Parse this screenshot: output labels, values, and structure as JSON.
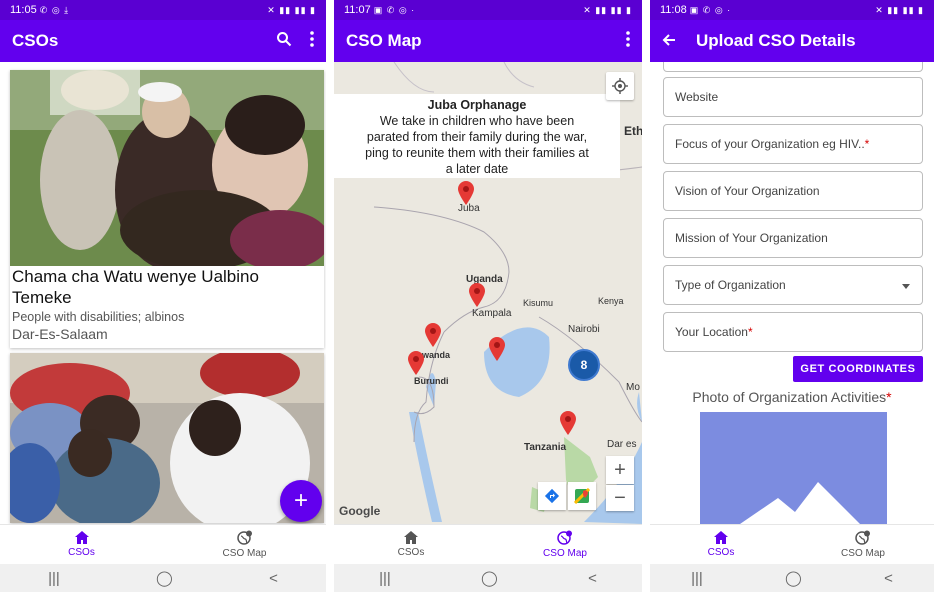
{
  "screen1": {
    "status": {
      "time": "11:05",
      "icons": "✆ ◎ ⤓",
      "right": "✕ ▮▮ ▮▮ ▮"
    },
    "appbar": {
      "title": "CSOs",
      "search_icon": "search-icon",
      "more_icon": "more-vert-icon"
    },
    "cards": [
      {
        "name": "Chama cha Watu wenye Ualbino Temeke",
        "focus": "People with disabilities; albinos",
        "location": "Dar-Es-Salaam"
      },
      {
        "name": "",
        "focus": "",
        "location": ""
      }
    ],
    "fab": "+",
    "nav": [
      {
        "label": "CSOs",
        "icon": "home-icon",
        "active": true
      },
      {
        "label": "CSO Map",
        "icon": "globe-pin-icon",
        "active": false
      }
    ],
    "sysnav": [
      "|||",
      "◯",
      "<"
    ]
  },
  "screen2": {
    "status": {
      "time": "11:07",
      "icons": "▣ ✆ ◎  ·",
      "right": "✕ ▮▮ ▮▮ ▮"
    },
    "appbar": {
      "title": "CSO Map",
      "more_icon": "more-vert-icon"
    },
    "popup": {
      "title": "Juba Orphanage",
      "lines": [
        "We take in children who have been",
        "parated from their family during the war,",
        "ping to reunite them with their families at",
        "a later date"
      ]
    },
    "labels": {
      "juba": "Juba",
      "uganda": "Uganda",
      "kampala": "Kampala",
      "kisumu": "Kisumu",
      "kenya": "Kenya",
      "nairobi": "Nairobi",
      "rwanda": "wanda",
      "burundi": "Burundi",
      "tanzania": "Tanzania",
      "dar": "Dar es",
      "eth": "Eth",
      "mo": "Mo"
    },
    "cluster_count": "8",
    "zoom_in": "+",
    "zoom_out": "−",
    "google": "Google",
    "nav": [
      {
        "label": "CSOs",
        "icon": "home-icon",
        "active": false
      },
      {
        "label": "CSO Map",
        "icon": "globe-pin-icon",
        "active": true
      }
    ],
    "sysnav": [
      "|||",
      "◯",
      "<"
    ]
  },
  "screen3": {
    "status": {
      "time": "11:08",
      "icons": "▣ ✆ ◎  ·",
      "right": "✕ ▮▮ ▮▮ ▮"
    },
    "appbar": {
      "title": "Upload CSO Details",
      "back_icon": "arrow-back-icon"
    },
    "fields": [
      {
        "label": "Website",
        "required": false
      },
      {
        "label": "Focus of your Organization eg HIV..",
        "required": true
      },
      {
        "label": "Vision of Your Organization",
        "required": false
      },
      {
        "label": "Mission of Your Organization",
        "required": false
      },
      {
        "label": "Type of Organization",
        "required": false,
        "dropdown": true
      },
      {
        "label": "Your Location",
        "required": true
      }
    ],
    "required_mark": "*",
    "get_coordinates": "GET COORDINATES",
    "photo_heading": "Photo of Organization Activities",
    "nav": [
      {
        "label": "CSOs",
        "icon": "home-icon",
        "active": true
      },
      {
        "label": "CSO Map",
        "icon": "globe-pin-icon",
        "active": false
      }
    ],
    "sysnav": [
      "|||",
      "◯",
      "<"
    ]
  },
  "colors": {
    "primary": "#6200ee",
    "status_bar": "#5a00d2",
    "marker": "#e53935",
    "cluster": "#1a5aa8",
    "placeholder": "#7c8ce0"
  }
}
